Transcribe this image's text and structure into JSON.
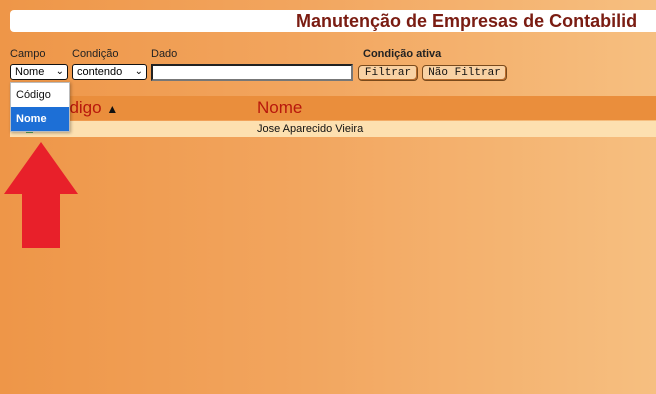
{
  "page": {
    "title": "Manutenção de Empresas de Contabilid"
  },
  "filters": {
    "campo_label": "Campo",
    "campo_value": "Nome",
    "campo_options": [
      "Código",
      "Nome"
    ],
    "condicao_label": "Condição",
    "condicao_value": "contendo",
    "dado_label": "Dado",
    "dado_value": "",
    "condicao_ativa_label": "Condição ativa",
    "filtrar_button": "Filtrar",
    "nao_filtrar_button": "Não Filtrar"
  },
  "table": {
    "columns": [
      {
        "label": "ódigo",
        "sort": "▲"
      },
      {
        "label": "Nome"
      }
    ],
    "rows": [
      {
        "codigo": "",
        "nome": "Jose Aparecido Vieira"
      }
    ]
  },
  "colors": {
    "accent": "#7a1c12",
    "header_text": "#b8180c",
    "arrow": "#e8202a",
    "selected_option": "#1d6fd6"
  }
}
